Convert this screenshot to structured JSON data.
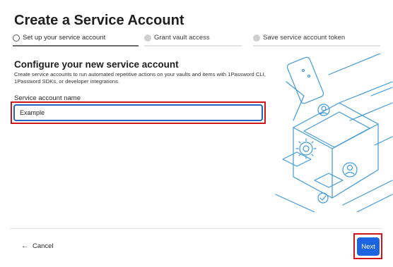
{
  "page": {
    "title": "Create a Service Account"
  },
  "steps": [
    {
      "label": "Set up your service account"
    },
    {
      "label": "Grant vault access"
    },
    {
      "label": "Save service account token"
    }
  ],
  "form": {
    "heading": "Configure your new service account",
    "description": "Create service accounts to run automated repetitive actions on your vaults and items with 1Password CLI, 1Password SDKs, or developer integrations.",
    "name_label": "Service account name",
    "name_value": "Example"
  },
  "footer": {
    "cancel_label": "Cancel",
    "next_label": "Next"
  },
  "icons": {
    "cancel": "arrow-left-icon",
    "illustration": "service-account-illustration"
  },
  "colors": {
    "accent": "#1c64e0",
    "highlight": "#d0161b",
    "input_border": "#2463c4",
    "illustration_stroke": "#3f9ad8"
  }
}
